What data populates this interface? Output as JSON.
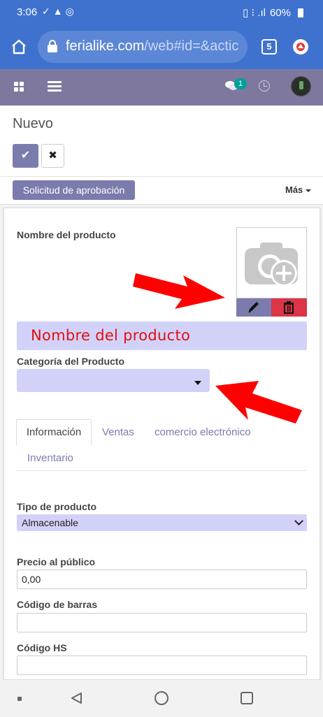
{
  "status_bar": {
    "time": "3:06",
    "battery": "60%"
  },
  "browser": {
    "url_host": "ferialike.com",
    "url_path": "/web#id=&actic",
    "tab_count": "5"
  },
  "app_nav": {
    "chat_badge": "1"
  },
  "control_panel": {
    "breadcrumb": "Nuevo",
    "save_icon": "✔",
    "discard_icon": "✖"
  },
  "statusbar": {
    "approval_button": "Solicitud de aprobación",
    "more_label": "Más"
  },
  "form": {
    "name_label": "Nombre del producto",
    "name_placeholder": "Nombre del producto",
    "category_label": "Categoría del Producto",
    "tabs": [
      "Información",
      "Ventas",
      "comercio electrónico",
      "Inventario"
    ],
    "product_type_label": "Tipo de producto",
    "product_type_value": "Almacenable",
    "price_label": "Precio al público",
    "price_value": "0,00",
    "barcode_label": "Código de barras",
    "barcode_value": "",
    "hs_label": "Código HS",
    "hs_value": ""
  },
  "colors": {
    "browser_bar": "#3f72cf",
    "odoo_nav": "#7e789e",
    "primary": "#7c7bad",
    "required_field": "#d2d2f9",
    "danger": "#dc3545",
    "annotation_red": "#ff0000"
  },
  "icons": [
    "home-icon",
    "lock-icon",
    "tabs-icon",
    "update-icon",
    "apps-icon",
    "menu-icon",
    "chat-icon",
    "clock-icon",
    "avatar",
    "camera-add-icon",
    "pencil-icon",
    "trash-icon",
    "caret-down-icon",
    "chevron-down-icon",
    "back-icon",
    "home-circle-icon",
    "recents-icon"
  ]
}
